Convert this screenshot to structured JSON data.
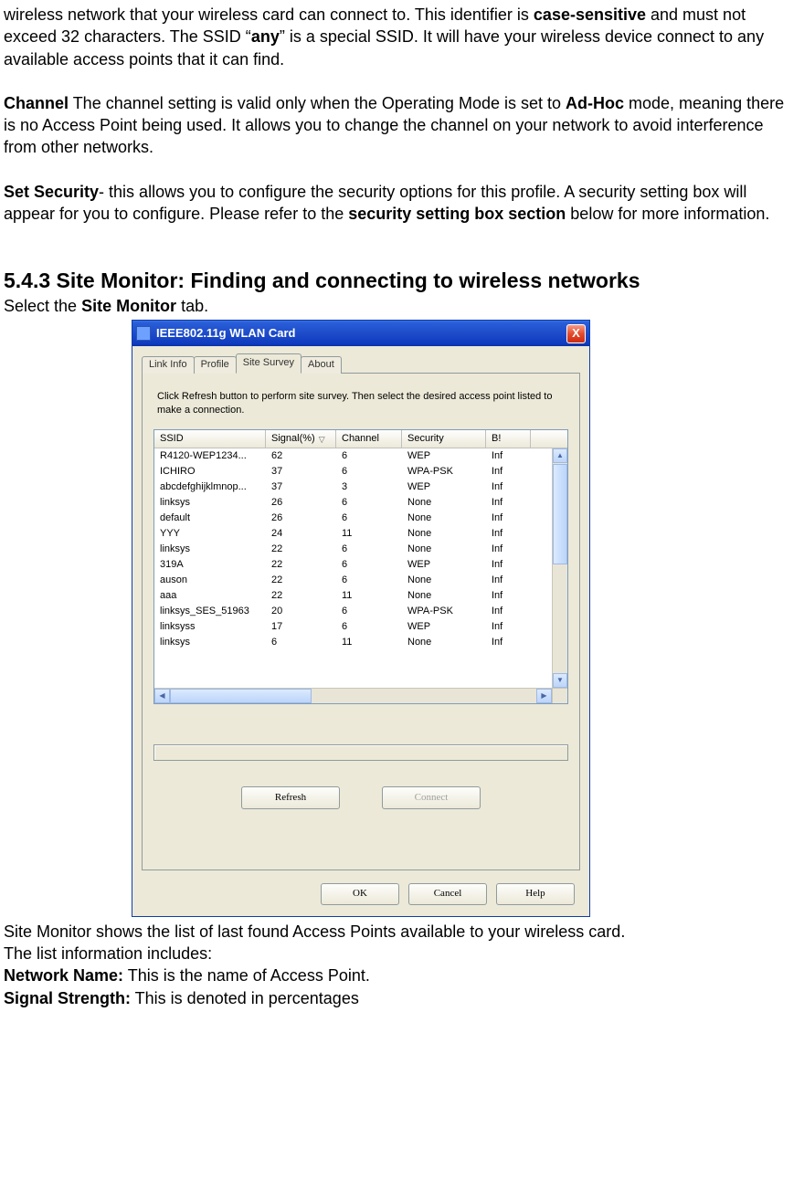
{
  "para1": {
    "pre": "wireless network that your wireless card can connect to. This identifier is ",
    "bold1": "case-sensitive",
    "mid1": " and must not exceed 32 characters. The SSID “",
    "bold2": "any",
    "mid2": "” is a special SSID. It will have your wireless device connect to any available access points that it can find."
  },
  "para2": {
    "bold": "Channel",
    "rest": " The channel setting is valid only when the Operating Mode is set to ",
    "bold2": "Ad-Hoc",
    "tail": " mode, meaning there is no Access Point being used. It allows you to change the channel on your network to avoid interference from other networks."
  },
  "para3": {
    "bold": "Set Security",
    "rest": "- this allows you to configure the security options for this profile. A security setting box will appear for you to configure. Please refer to the ",
    "bold2": "security setting box section",
    "tail": " below for more information."
  },
  "heading": "5.4.3 Site Monitor: Finding and connecting to wireless networks",
  "subhead": {
    "pre": "Select the ",
    "bold": "Site Monitor",
    "post": " tab."
  },
  "window": {
    "title": "IEEE802.11g WLAN Card",
    "close": "X",
    "tabs": [
      "Link Info",
      "Profile",
      "Site Survey",
      "About"
    ],
    "selectedTab": 2,
    "instructions": "Click Refresh button to perform site survey. Then select the desired access point listed to make a connection.",
    "columns": [
      "SSID",
      "Signal(%)",
      "Channel",
      "Security",
      "B!"
    ],
    "rows": [
      {
        "ssid": "R4120-WEP1234...",
        "signal": "62",
        "channel": "6",
        "security": "WEP",
        "b": "Inf"
      },
      {
        "ssid": "ICHIRO",
        "signal": "37",
        "channel": "6",
        "security": "WPA-PSK",
        "b": "Inf"
      },
      {
        "ssid": "abcdefghijklmnop...",
        "signal": "37",
        "channel": "3",
        "security": "WEP",
        "b": "Inf"
      },
      {
        "ssid": "linksys",
        "signal": "26",
        "channel": "6",
        "security": "None",
        "b": "Inf"
      },
      {
        "ssid": "default",
        "signal": "26",
        "channel": "6",
        "security": "None",
        "b": "Inf"
      },
      {
        "ssid": "YYY",
        "signal": "24",
        "channel": "11",
        "security": "None",
        "b": "Inf"
      },
      {
        "ssid": "linksys",
        "signal": "22",
        "channel": "6",
        "security": "None",
        "b": "Inf"
      },
      {
        "ssid": "319A",
        "signal": "22",
        "channel": "6",
        "security": "WEP",
        "b": "Inf"
      },
      {
        "ssid": "auson",
        "signal": "22",
        "channel": "6",
        "security": "None",
        "b": "Inf"
      },
      {
        "ssid": "aaa",
        "signal": "22",
        "channel": "11",
        "security": "None",
        "b": "Inf"
      },
      {
        "ssid": "linksys_SES_51963",
        "signal": "20",
        "channel": "6",
        "security": "WPA-PSK",
        "b": "Inf"
      },
      {
        "ssid": "linksyss",
        "signal": "17",
        "channel": "6",
        "security": "WEP",
        "b": "Inf"
      },
      {
        "ssid": "linksys",
        "signal": "6",
        "channel": "11",
        "security": "None",
        "b": "Inf"
      }
    ],
    "buttons": {
      "refresh": "Refresh",
      "connect": "Connect",
      "ok": "OK",
      "cancel": "Cancel",
      "help": "Help"
    }
  },
  "after": {
    "p1": "Site Monitor shows the list of last found Access Points available to your wireless card.",
    "p2": "The list information includes:",
    "p3": {
      "bold": "Network Name:",
      "rest": " This is the name of Access Point."
    },
    "p4": {
      "bold": "Signal Strength:",
      "rest": " This is denoted in percentages"
    }
  }
}
